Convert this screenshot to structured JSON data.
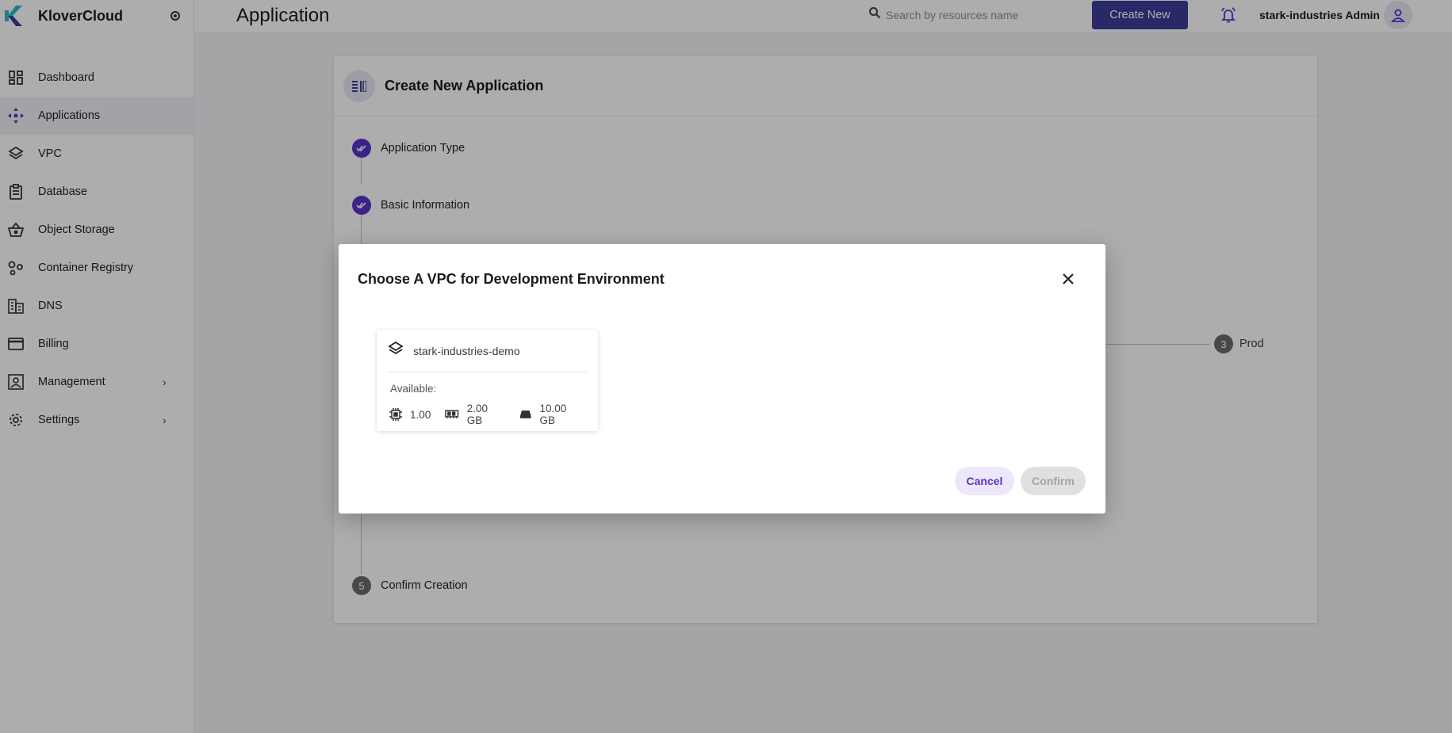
{
  "brand": {
    "name": "KloverCloud"
  },
  "sidebar": {
    "items": [
      {
        "label": "Dashboard",
        "icon": "dashboard-icon"
      },
      {
        "label": "Applications",
        "icon": "applications-icon",
        "active": true
      },
      {
        "label": "VPC",
        "icon": "layers-icon"
      },
      {
        "label": "Database",
        "icon": "database-icon"
      },
      {
        "label": "Object Storage",
        "icon": "basket-icon"
      },
      {
        "label": "Container Registry",
        "icon": "registry-icon"
      },
      {
        "label": "DNS",
        "icon": "dns-icon"
      },
      {
        "label": "Billing",
        "icon": "credit-card-icon"
      },
      {
        "label": "Management",
        "icon": "management-icon",
        "expandable": true
      },
      {
        "label": "Settings",
        "icon": "gear-icon",
        "expandable": true
      }
    ]
  },
  "header": {
    "title": "Application",
    "search_placeholder": "Search by resources name",
    "create_label": "Create New",
    "user_name": "stark-industries Admin"
  },
  "wizard": {
    "title": "Create New Application",
    "steps": [
      {
        "label": "Application Type",
        "done": true
      },
      {
        "label": "Basic Information",
        "done": true
      },
      {
        "num": "5",
        "label": "Confirm Creation"
      }
    ],
    "env_step": {
      "num": "3",
      "label": "Prod"
    }
  },
  "dialog": {
    "title": "Choose A VPC for Development Environment",
    "vpc": {
      "name": "stark-industries-demo",
      "available_label": "Available:",
      "cpu": "1.00",
      "memory": "2.00 GB",
      "storage": "10.00 GB"
    },
    "cancel_label": "Cancel",
    "confirm_label": "Confirm"
  },
  "colors": {
    "primary": "#3f3d99",
    "accent": "#5b34c7",
    "cancel_bg": "#ede7fb",
    "disabled_bg": "#e0e0e0"
  }
}
